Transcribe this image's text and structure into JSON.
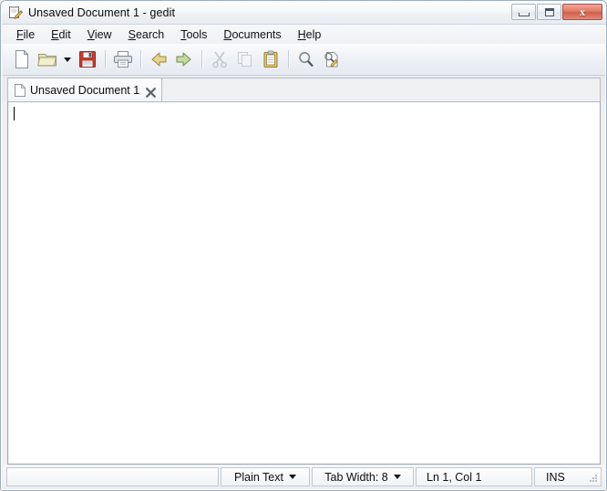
{
  "window": {
    "title": "Unsaved Document 1 - gedit",
    "app_icon": "gedit-notepad-pencil-icon",
    "controls": {
      "minimize": "minimize-button",
      "maximize": "maximize-button",
      "close": "close-button",
      "close_glyph": "x"
    }
  },
  "menubar": {
    "items": [
      {
        "label": "File",
        "mnemonic": "F"
      },
      {
        "label": "Edit",
        "mnemonic": "E"
      },
      {
        "label": "View",
        "mnemonic": "V"
      },
      {
        "label": "Search",
        "mnemonic": "S"
      },
      {
        "label": "Tools",
        "mnemonic": "T"
      },
      {
        "label": "Documents",
        "mnemonic": "D"
      },
      {
        "label": "Help",
        "mnemonic": "H"
      }
    ]
  },
  "toolbar": {
    "buttons": [
      {
        "name": "new-document-icon",
        "title": "New",
        "enabled": true
      },
      {
        "name": "open-folder-icon",
        "title": "Open",
        "enabled": true
      },
      {
        "name": "open-dropdown-arrow-icon",
        "title": "Open recent",
        "enabled": true
      },
      {
        "name": "save-floppy-icon",
        "title": "Save",
        "enabled": true
      },
      {
        "name": "print-icon",
        "title": "Print",
        "enabled": true
      },
      {
        "name": "undo-icon",
        "title": "Undo",
        "enabled": true
      },
      {
        "name": "redo-icon",
        "title": "Redo",
        "enabled": true
      },
      {
        "name": "cut-scissors-icon",
        "title": "Cut",
        "enabled": false
      },
      {
        "name": "copy-icon",
        "title": "Copy",
        "enabled": false
      },
      {
        "name": "paste-clipboard-icon",
        "title": "Paste",
        "enabled": true
      },
      {
        "name": "find-magnifier-icon",
        "title": "Find",
        "enabled": true
      },
      {
        "name": "replace-icon",
        "title": "Replace",
        "enabled": true
      }
    ]
  },
  "tabs": [
    {
      "label": "Unsaved Document 1",
      "icon": "document-icon",
      "close_icon": "close-tab-icon",
      "active": true
    }
  ],
  "editor": {
    "content": "",
    "caret_visible": true
  },
  "statusbar": {
    "message": "",
    "language": "Plain Text",
    "tab_width": "Tab Width: 8",
    "position": "Ln 1, Col 1",
    "insert_mode": "INS"
  },
  "colors": {
    "accent_close": "#cf5f49",
    "window_border": "#9badc0",
    "editor_background": "#ffffff",
    "chrome_background": "#eef1f5"
  }
}
